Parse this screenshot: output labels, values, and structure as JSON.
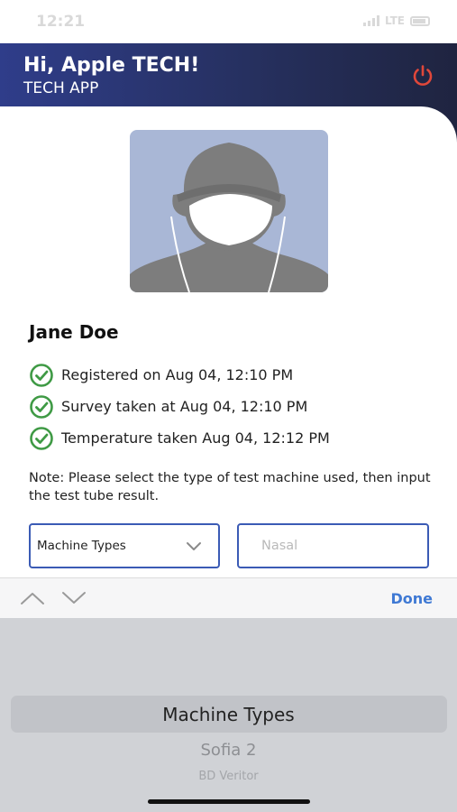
{
  "status_bar": {
    "time": "12:21",
    "network": "LTE"
  },
  "header": {
    "greeting": "Hi, Apple TECH!",
    "subtitle": "TECH APP",
    "logout_icon": "power-icon",
    "logout_color": "#e0473a"
  },
  "profile": {
    "name": "Jane Doe",
    "checks": [
      {
        "text": "Registered on Aug 04, 12:10 PM"
      },
      {
        "text": "Survey taken at Aug 04, 12:10 PM"
      },
      {
        "text": "Temperature taken Aug 04, 12:12 PM"
      }
    ]
  },
  "note": "Note: Please select the type of test machine used, then input the test tube result.",
  "machine_select": {
    "value": "Machine Types"
  },
  "result_input": {
    "placeholder": "Nasal",
    "value": ""
  },
  "toolbar": {
    "done_label": "Done"
  },
  "picker": {
    "options": [
      "Machine Types",
      "Sofia 2",
      "BD Veritor"
    ],
    "selected_index": 0
  },
  "colors": {
    "accent": "#3f79d4",
    "header_start": "#2f3d8a",
    "check_green": "#3f9a45",
    "field_border": "#3b5bb5"
  }
}
